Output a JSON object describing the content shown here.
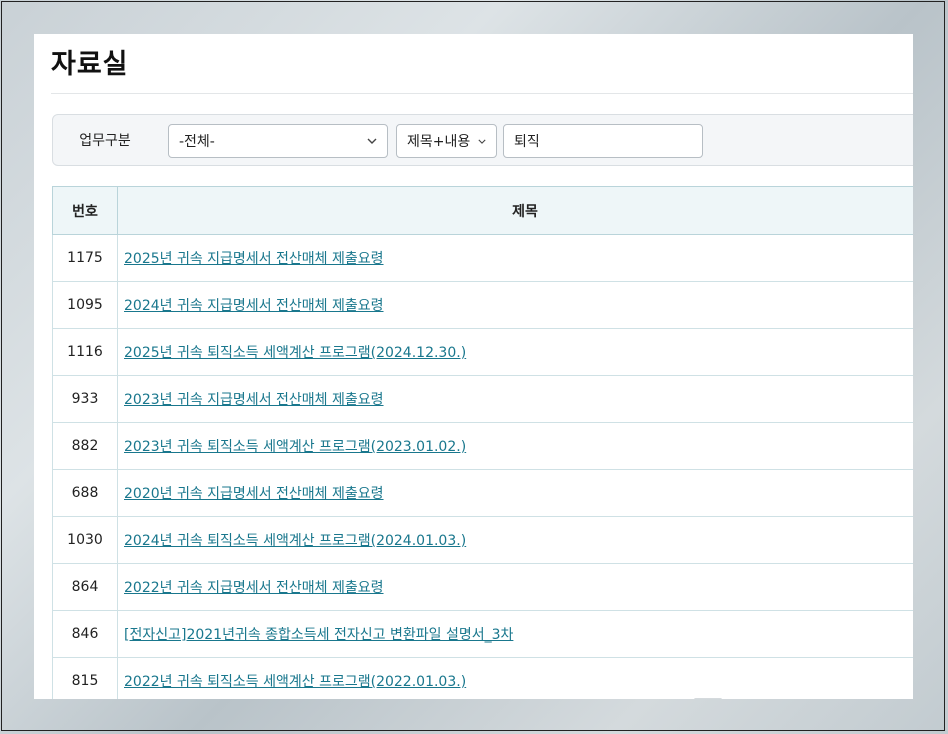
{
  "page": {
    "title": "자료실"
  },
  "search": {
    "category_label": "업무구분",
    "category_selected": "-전체-",
    "field_selected": "제목+내용",
    "query": "퇴직"
  },
  "table": {
    "headers": {
      "number": "번호",
      "title": "제목"
    },
    "rows": [
      {
        "number": "1175",
        "title": "2025년 귀속 지급명세서 전산매체 제출요령"
      },
      {
        "number": "1095",
        "title": "2024년 귀속 지급명세서 전산매체 제출요령"
      },
      {
        "number": "1116",
        "title": "2025년 귀속 퇴직소득 세액계산 프로그램(2024.12.30.)"
      },
      {
        "number": "933",
        "title": "2023년 귀속 지급명세서 전산매체 제출요령"
      },
      {
        "number": "882",
        "title": "2023년 귀속 퇴직소득 세액계산 프로그램(2023.01.02.)"
      },
      {
        "number": "688",
        "title": "2020년 귀속 지급명세서 전산매체 제출요령"
      },
      {
        "number": "1030",
        "title": "2024년 귀속 퇴직소득 세액계산 프로그램(2024.01.03.)"
      },
      {
        "number": "864",
        "title": "2022년 귀속 지급명세서 전산매체 제출요령"
      },
      {
        "number": "846",
        "title": "[전자신고]2021년귀속 종합소득세 전자신고 변환파일 설명서_3차"
      },
      {
        "number": "815",
        "title": "2022년 귀속 퇴직소득 세액계산 프로그램(2022.01.03.)"
      }
    ]
  }
}
